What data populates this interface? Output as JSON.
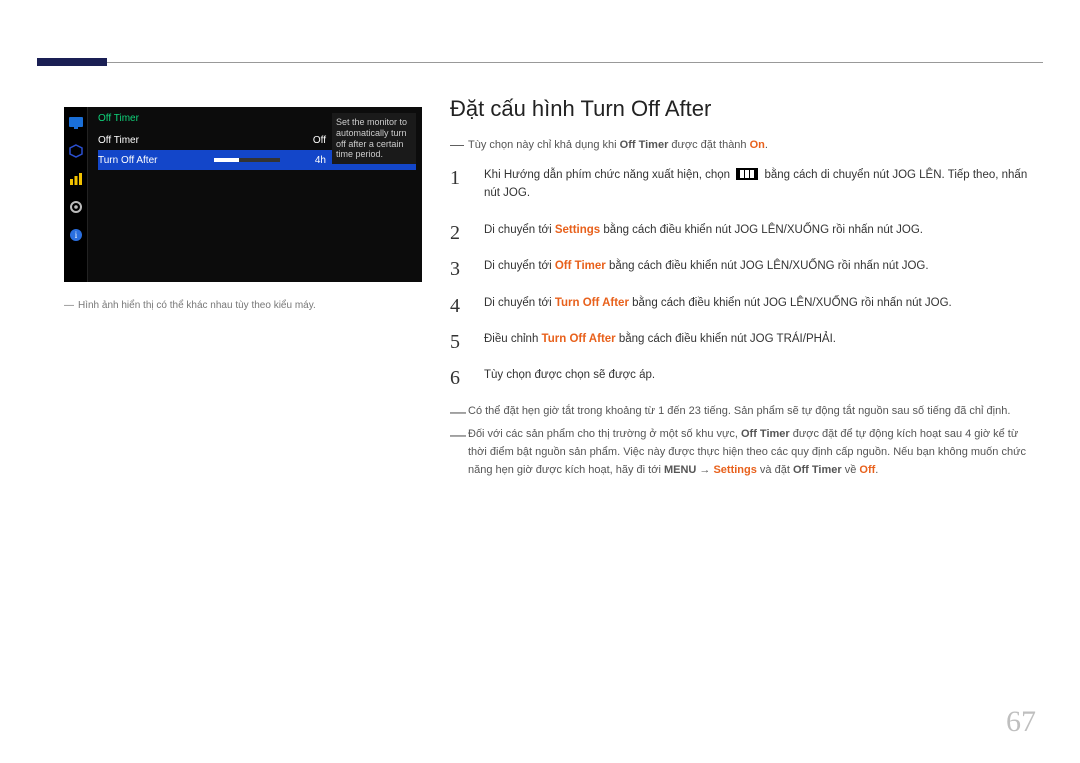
{
  "osd": {
    "header": "Off Timer",
    "row_off_timer_label": "Off Timer",
    "row_off_timer_value": "Off",
    "row_turn_off_after_label": "Turn Off After",
    "row_turn_off_after_value": "4h",
    "desc": "Set the monitor to automatically turn off after a certain time period."
  },
  "left_note": "Hình ảnh hiển thị có thể khác nhau tùy theo kiểu máy.",
  "heading": "Đặt cấu hình Turn Off After",
  "topnote": {
    "pre": "Tùy chọn này chỉ khả dụng khi ",
    "off_timer": "Off Timer",
    "mid": " được đặt thành ",
    "on": "On",
    "post": "."
  },
  "steps": {
    "s1": {
      "num": "1",
      "pre": "Khi Hướng dẫn phím chức năng xuất hiện, chọn ",
      "post": " bằng cách di chuyển nút JOG LÊN. Tiếp theo, nhấn nút JOG."
    },
    "s2": {
      "num": "2",
      "pre": "Di chuyển tới ",
      "kw": "Settings",
      "post": " bằng cách điều khiển nút JOG LÊN/XUỐNG rồi nhấn nút JOG."
    },
    "s3": {
      "num": "3",
      "pre": "Di chuyển tới ",
      "kw": "Off Timer",
      "post": " bằng cách điều khiển nút JOG LÊN/XUỐNG rồi nhấn nút JOG."
    },
    "s4": {
      "num": "4",
      "pre": "Di chuyển tới ",
      "kw": "Turn Off After",
      "post": " bằng cách điều khiển nút JOG LÊN/XUỐNG rồi nhấn nút JOG."
    },
    "s5": {
      "num": "5",
      "pre": "Điều chỉnh ",
      "kw": "Turn Off After",
      "post": " bằng cách điều khiển nút JOG TRÁI/PHẢI."
    },
    "s6": {
      "num": "6",
      "text": "Tùy chọn được chọn sẽ được áp."
    }
  },
  "bottom": {
    "n1": "Có thể đặt hẹn giờ tắt trong khoảng từ 1 đến 23 tiếng. Sản phẩm sẽ tự động tắt nguồn sau số tiếng đã chỉ định.",
    "n2": {
      "pre": "Đối với các sản phẩm cho thị trường ở một số khu vực, ",
      "off_timer": "Off Timer",
      "mid1": " được đặt để tự động kích hoạt sau 4 giờ kể từ thời điểm bật nguồn sản phẩm. Việc này được thực hiện theo các quy định cấp nguồn. Nếu bạn không muốn chức năng hẹn giờ được kích hoạt, hãy đi tới ",
      "menu": "MENU",
      "arrow": " → ",
      "settings": "Settings",
      "mid2": " và đặt ",
      "off_timer2": "Off Timer",
      "mid3": " về ",
      "off": "Off",
      "post": "."
    }
  },
  "page_number": "67"
}
